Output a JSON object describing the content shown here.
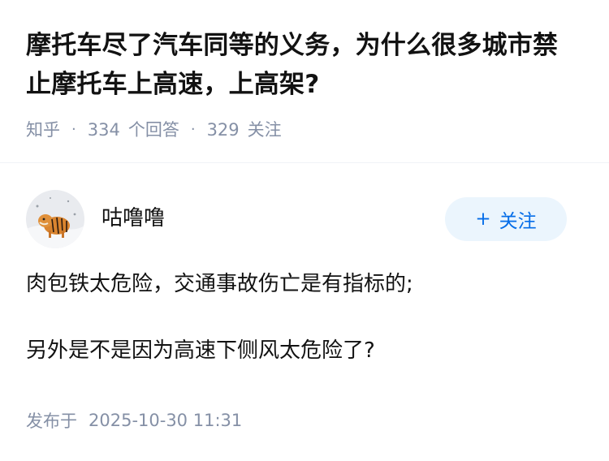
{
  "question": {
    "title": "摩托车尽了汽车同等的义务，为什么很多城市禁止摩托车上高速，上高架?",
    "source": "知乎",
    "separator": "·",
    "answer_count": "334",
    "answer_label": "个回答",
    "follower_count": "329",
    "follower_label": "关注"
  },
  "answer": {
    "author": {
      "name": "咕噜噜",
      "avatar_icon": "tiger-avatar"
    },
    "follow_button": {
      "icon": "+",
      "label": "关注"
    },
    "paragraphs": [
      "肉包铁太危险，交通事故伤亡是有指标的;",
      "另外是不是因为高速下侧风太危险了?"
    ],
    "publish_label": "发布于",
    "publish_time": "2025-10-30 11:31"
  },
  "colors": {
    "title": "#121212",
    "meta": "#8590a6",
    "accent": "#056de8",
    "follow_bg": "#ebf5fd"
  }
}
